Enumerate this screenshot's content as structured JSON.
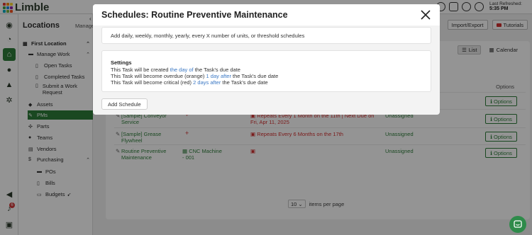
{
  "app": {
    "logo_text": "Limble",
    "last_refreshed_label": "Last Refreshed:",
    "last_refreshed_time": "5:35 PM"
  },
  "sidebar": {
    "title": "Locations",
    "manage_label": "Manage",
    "location": "First Location",
    "items": {
      "manage_work": "Manage Work",
      "open_tasks": "Open Tasks",
      "completed_tasks": "Completed Tasks",
      "submit_request": "Submit a Work Request",
      "assets": "Assets",
      "pms": "PMs",
      "parts": "Parts",
      "teams": "Teams",
      "vendors": "Vendors",
      "purchasing": "Purchasing",
      "pos": "POs",
      "bills": "Bills",
      "budgets": "Budgets"
    },
    "notification_count": "6"
  },
  "header": {
    "import_export": "Import/Export",
    "tutorials": "Tutorials"
  },
  "view": {
    "list": "List",
    "calendar": "Calendar",
    "options_col": "Options"
  },
  "rows": [
    {
      "name": "",
      "asset": "",
      "schedule": "",
      "assigned": "",
      "options": "Options"
    },
    {
      "name": "[Sample] Conveyor Service",
      "asset": "",
      "schedule": "Repeats Every 1 Month on the 11th | Next Due on Fri, Apr 11, 2025",
      "assigned": "Unassigned",
      "options": "Options"
    },
    {
      "name": "[Sample] Grease Flywheel",
      "asset": "",
      "schedule": "Repeats Every 6 Months on the 17th",
      "assigned": "Unassigned",
      "options": "Options"
    },
    {
      "name": "Routine Preventive Maintenance",
      "asset": "CNC Machine - 001",
      "schedule": "",
      "assigned": "Unassigned",
      "options": "Options"
    }
  ],
  "pager": {
    "per_page": "10",
    "label": "items per page"
  },
  "modal": {
    "title": "Schedules: Routine Preventive Maintenance",
    "description": "Add daily, weekly, monthly, yearly, every X number of units, or threshold schedules",
    "settings_title": "Settings",
    "line1": {
      "pre": "This Task will be created ",
      "link": "the day of",
      "post": " the Task's due date"
    },
    "line2": {
      "pre": "This Task will become overdue (orange) ",
      "link": "1 day after",
      "post": " the Task's due date"
    },
    "line3": {
      "pre": "This Task will become critical (red) ",
      "link": "2 days after",
      "post": " the Task's due date"
    },
    "add_button": "Add Schedule"
  },
  "colors": {
    "brand_green": "#2e7d3a",
    "link_blue": "#3b78c4",
    "critical_red": "#d32f2f"
  }
}
